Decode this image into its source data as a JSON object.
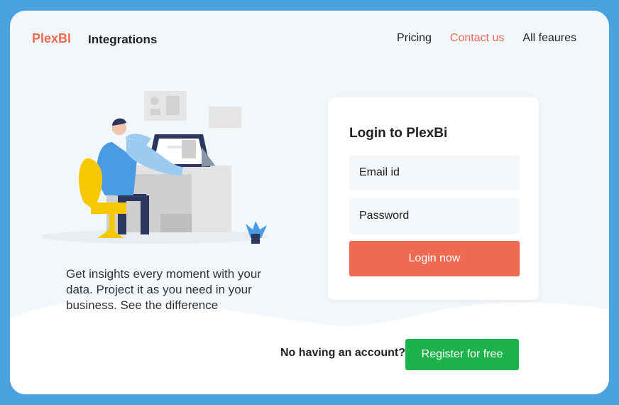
{
  "header": {
    "logo": "PlexBI",
    "nav_left": "Integrations",
    "nav_right": [
      "Pricing",
      "Contact us",
      "All feaures"
    ]
  },
  "hero": {
    "tagline": "Get insights every moment with your data. Project it as you need in your business. See the difference"
  },
  "login": {
    "title": "Login to PlexBi",
    "email_placeholder": "Email id",
    "password_placeholder": "Password",
    "button": "Login now"
  },
  "footer": {
    "register_text": "No having an account?",
    "register_button": "Register for free"
  },
  "colors": {
    "frame": "#4aa3de",
    "accent": "#ef6a53",
    "success": "#1db24a"
  }
}
